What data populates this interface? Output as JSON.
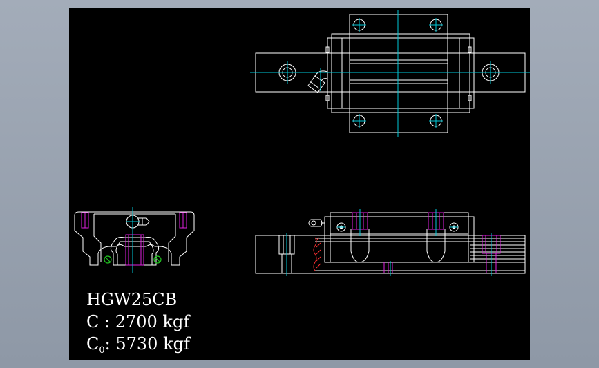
{
  "labels": {
    "model": "HGW25CB",
    "dynamic_load": "C : 2700 kgf",
    "static_load_prefix": "C",
    "static_load_subscript": "0",
    "static_load_value": ": 5730 kgf"
  },
  "colors": {
    "background": "#8e98a6",
    "viewport": "#000000",
    "line": "#ffffff",
    "center_line": "#00c8d8",
    "hidden_line": "#e020e0",
    "hatch": "#ff3030",
    "grease": "#20c020"
  }
}
